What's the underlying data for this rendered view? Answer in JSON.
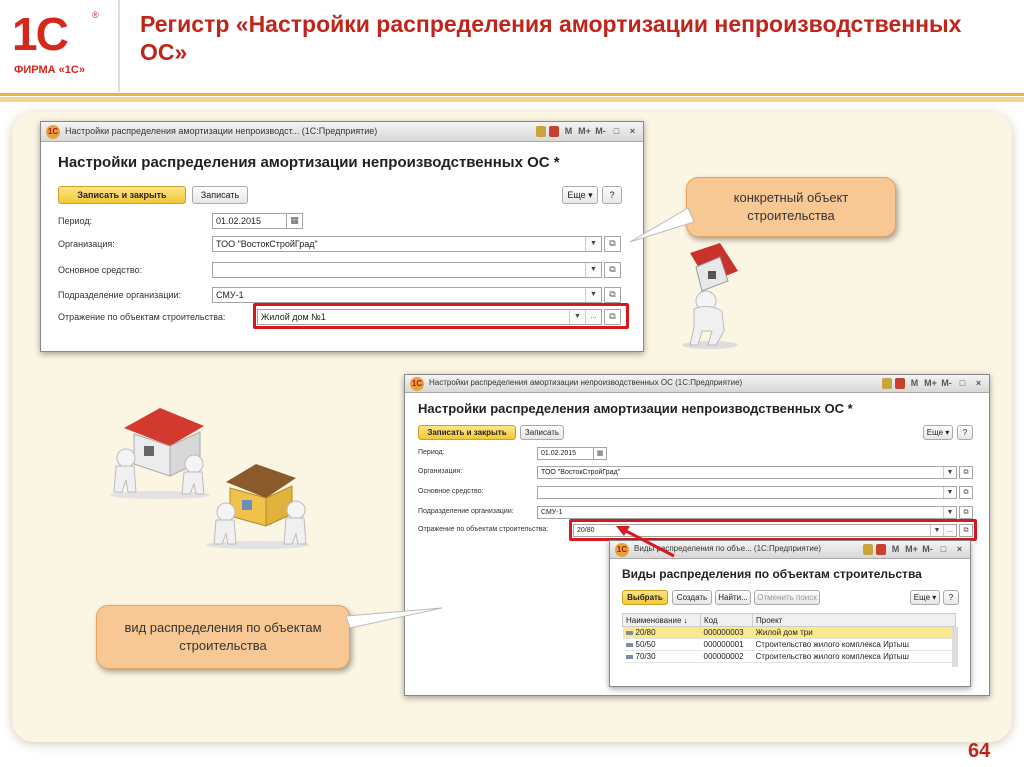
{
  "slide": {
    "logo": {
      "mark": "1С",
      "reg": "®",
      "text": "ФИРМА «1С»"
    },
    "title": "Регистр «Настройки распределения амортизации непроизводственных ОС»",
    "page_number": "64",
    "colors": {
      "title_red": "#c0251c",
      "callout_fill": "#f8c894",
      "highlight_red": "#d7191f",
      "band": "#e7b24a"
    }
  },
  "window1": {
    "titlebar": {
      "title": "Настройки распределения амортизации непроизводст... (1С:Предприятие)",
      "icon": "1c-app-icon",
      "buttons": [
        "calendar-icon",
        "table-icon",
        "M",
        "M+",
        "M-",
        "□",
        "×"
      ]
    },
    "form_title": "Настройки распределения амортизации непроизводственных ОС *",
    "toolbar": {
      "save_close": "Записать и закрыть",
      "save": "Записать",
      "more": "Еще ▾",
      "help": "?"
    },
    "fields": {
      "period_label": "Период:",
      "period_value": "01.02.2015",
      "org_label": "Организация:",
      "org_value": "ТОО \"ВостокСтройГрад\"",
      "asset_label": "Основное средство:",
      "asset_value": "",
      "dept_label": "Подразделение организации:",
      "dept_value": "СМУ-1",
      "reflect_label": "Отражение по объектам строительства:",
      "reflect_value": "Жилой дом №1"
    }
  },
  "window2": {
    "titlebar": {
      "title": "Настройки распределения амортизации непроизводственных ОС (1С:Предприятие)",
      "buttons": [
        "calendar-icon",
        "table-icon",
        "M",
        "M+",
        "M-",
        "□",
        "×"
      ]
    },
    "form_title": "Настройки распределения амортизации непроизводственных ОС *",
    "toolbar": {
      "save_close": "Записать и закрыть",
      "save": "Записать",
      "more": "Еще ▾",
      "help": "?"
    },
    "fields": {
      "period_label": "Период:",
      "period_value": "01.02.2015",
      "org_label": "Организация:",
      "org_value": "ТОО \"ВостокСтройГрад\"",
      "asset_label": "Основное средство:",
      "asset_value": "",
      "dept_label": "Подразделение организации:",
      "dept_value": "СМУ-1",
      "reflect_label": "Отражение по объектам строительства:",
      "reflect_value": "20/80"
    }
  },
  "window3": {
    "titlebar": {
      "title": "Виды распределения по объе... (1С:Предприятие)",
      "buttons": [
        "calendar-icon",
        "table-icon",
        "M",
        "M+",
        "M-",
        "□",
        "×"
      ]
    },
    "form_title": "Виды распределения по объектам строительства",
    "toolbar": {
      "select": "Выбрать",
      "create": "Создать",
      "find": "Найти...",
      "cancel_search": "Отменить поиск",
      "more": "Еще ▾",
      "help": "?"
    },
    "table": {
      "columns": [
        "Наименование ↓",
        "Код",
        "Проект"
      ],
      "rows": [
        {
          "name": "20/80",
          "code": "000000003",
          "project": "Жилой дом три",
          "selected": true
        },
        {
          "name": "50/50",
          "code": "000000001",
          "project": "Строительство жилого комплекса Иртыш",
          "selected": false
        },
        {
          "name": "70/30",
          "code": "000000002",
          "project": "Строительство жилого комплекса Иртыш",
          "selected": false
        }
      ]
    }
  },
  "callouts": {
    "object": "конкретный объект строительства",
    "distribution": "вид распределения по объектам строительства"
  }
}
